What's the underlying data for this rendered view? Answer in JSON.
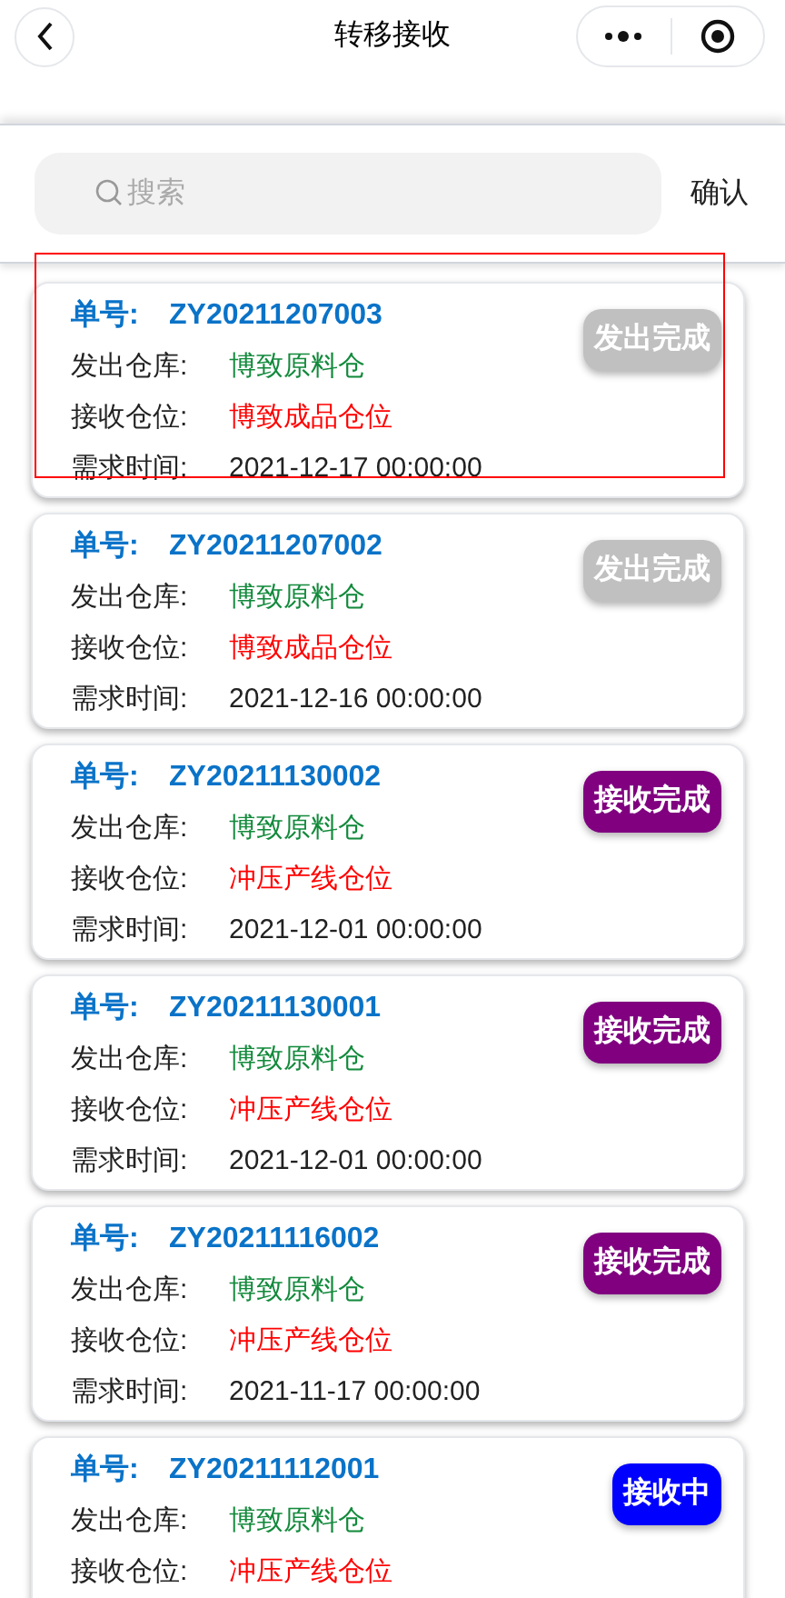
{
  "nav": {
    "title": "转移接收"
  },
  "search": {
    "placeholder": "搜索",
    "confirm": "确认"
  },
  "orders": [
    {
      "number_label": "单号:",
      "number": "ZY20211207003",
      "from_label": "发出仓库:",
      "from": "博致原料仓",
      "to_label": "接收仓位:",
      "to": "博致成品仓位",
      "time_label": "需求时间:",
      "time": "2021-12-17 00:00:00",
      "status": "发出完成",
      "color": "#c0c0c0",
      "highlighted": true
    },
    {
      "number_label": "单号:",
      "number": "ZY20211207002",
      "from_label": "发出仓库:",
      "from": "博致原料仓",
      "to_label": "接收仓位:",
      "to": "博致成品仓位",
      "time_label": "需求时间:",
      "time": "2021-12-16 00:00:00",
      "status": "发出完成",
      "color": "#c0c0c0",
      "highlighted": false
    },
    {
      "number_label": "单号:",
      "number": "ZY20211130002",
      "from_label": "发出仓库:",
      "from": "博致原料仓",
      "to_label": "接收仓位:",
      "to": "冲压产线仓位",
      "time_label": "需求时间:",
      "time": "2021-12-01 00:00:00",
      "status": "接收完成",
      "color": "#800080",
      "highlighted": false
    },
    {
      "number_label": "单号:",
      "number": "ZY20211130001",
      "from_label": "发出仓库:",
      "from": "博致原料仓",
      "to_label": "接收仓位:",
      "to": "冲压产线仓位",
      "time_label": "需求时间:",
      "time": "2021-12-01 00:00:00",
      "status": "接收完成",
      "color": "#800080",
      "highlighted": false
    },
    {
      "number_label": "单号:",
      "number": "ZY20211116002",
      "from_label": "发出仓库:",
      "from": "博致原料仓",
      "to_label": "接收仓位:",
      "to": "冲压产线仓位",
      "time_label": "需求时间:",
      "time": "2021-11-17 00:00:00",
      "status": "接收完成",
      "color": "#800080",
      "highlighted": false
    },
    {
      "number_label": "单号:",
      "number": "ZY20211112001",
      "from_label": "发出仓库:",
      "from": "博致原料仓",
      "to_label": "接收仓位:",
      "to": "冲压产线仓位",
      "status": "接收中",
      "color": "#0000ff",
      "highlighted": false
    }
  ]
}
